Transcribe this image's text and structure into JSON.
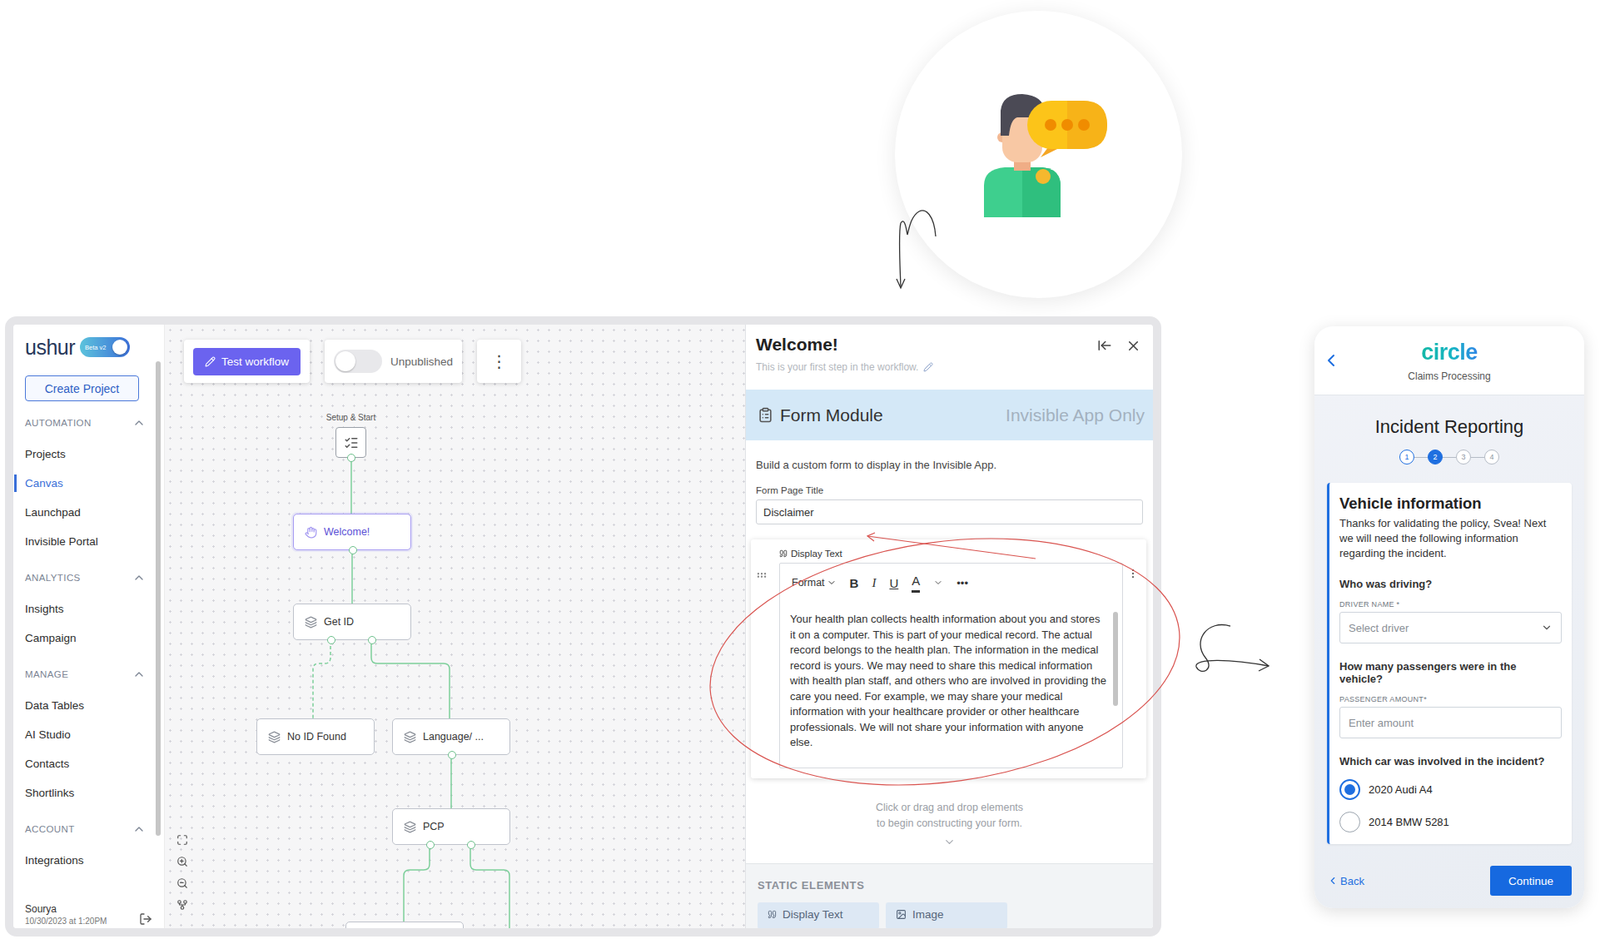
{
  "sidebar": {
    "logo": "ushur",
    "beta_toggle": {
      "label": "Beta v2",
      "on": true
    },
    "create_button": "Create Project",
    "sections": [
      {
        "title": "AUTOMATION",
        "expanded": true,
        "items": [
          {
            "label": "Projects",
            "selected": false
          },
          {
            "label": "Canvas",
            "selected": true
          },
          {
            "label": "Launchpad",
            "selected": false
          },
          {
            "label": "Invisible Portal",
            "selected": false
          }
        ]
      },
      {
        "title": "ANALYTICS",
        "expanded": true,
        "items": [
          {
            "label": "Insights",
            "selected": false
          },
          {
            "label": "Campaign",
            "selected": false
          }
        ]
      },
      {
        "title": "MANAGE",
        "expanded": true,
        "items": [
          {
            "label": "Data Tables",
            "selected": false
          },
          {
            "label": "AI Studio",
            "selected": false
          },
          {
            "label": "Contacts",
            "selected": false
          },
          {
            "label": "Shortlinks",
            "selected": false
          }
        ]
      },
      {
        "title": "ACCOUNT",
        "expanded": true,
        "items": [
          {
            "label": "Integrations",
            "selected": false
          }
        ]
      }
    ],
    "user": {
      "name": "Sourya",
      "time": "10/30/2023 at 1:20PM"
    }
  },
  "canvas": {
    "test_button": "Test workflow",
    "publish_toggle": {
      "label": "Unpublished",
      "on": false
    },
    "menu": "⋮",
    "nodes": [
      {
        "kind": "start",
        "label": "Setup & Start",
        "selected": false
      },
      {
        "kind": "welcome",
        "label": "Welcome!",
        "selected": true
      },
      {
        "kind": "step",
        "label": "Get ID",
        "selected": false
      },
      {
        "kind": "step",
        "label": "No ID Found",
        "selected": false
      },
      {
        "kind": "step",
        "label": "Language/ ...",
        "selected": false
      },
      {
        "kind": "step",
        "label": "PCP",
        "selected": false
      },
      {
        "kind": "cut-off",
        "label": "",
        "selected": false
      }
    ],
    "edges": [
      {
        "dashed": false
      },
      {
        "dashed": false
      },
      {
        "dashed": true
      },
      {
        "dashed": false
      },
      {
        "dashed": false
      },
      {
        "dashed": false
      },
      {
        "dashed": false
      }
    ]
  },
  "panel": {
    "title": "Welcome!",
    "subtitle": "This is your first step in the workflow.",
    "module": {
      "title": "Form Module",
      "tag": "Invisible App Only"
    },
    "description": "Build a custom form to display in the Invisible App.",
    "page_title": {
      "label": "Form Page Title",
      "value": "Disclaimer"
    },
    "element": {
      "label": "Display Text",
      "toolbar": {
        "format": "Format",
        "buttons": [
          {
            "label": "B",
            "kind": "bold"
          },
          {
            "label": "I",
            "kind": "italic"
          },
          {
            "label": "U",
            "kind": "underline"
          },
          {
            "label": "A",
            "kind": "color"
          }
        ],
        "more": "•••"
      },
      "text": "Your health plan collects health information about you and stores it on a computer. This is part of your medical record. The actual record belongs to the health plan. The information in the medical record is yours. We may need to share this medical information with health plan staff, and others who are involved in providing the care you need. For example, we may share your medical information with your healthcare provider or other healthcare professionals. We will not share your information with anyone else.",
      "scroll_level": 0.68
    },
    "hint": [
      "Click or drag and drop elements",
      "to begin constructing your form."
    ],
    "static": {
      "title": "STATIC ELEMENTS",
      "items": [
        {
          "label": "Display Text",
          "kind": "text"
        },
        {
          "label": "Image",
          "kind": "image"
        }
      ]
    }
  },
  "phone": {
    "logo": "circle",
    "subtitle": "Claims Processing",
    "title": "Incident Reporting",
    "steps": [
      {
        "label": "1",
        "status": "done"
      },
      {
        "label": "2",
        "status": "current"
      },
      {
        "label": "3",
        "status": "todo"
      },
      {
        "label": "4",
        "status": "todo"
      }
    ],
    "card": {
      "title": "Vehicle information",
      "text": "Thanks for validating the policy, Svea! Next we will need the following information regarding the incident.",
      "fields": [
        {
          "kind": "select",
          "question": "Who was driving?",
          "label": "DRIVER NAME *",
          "placeholder": "Select driver"
        },
        {
          "kind": "input",
          "question": "How many passengers were in the vehicle?",
          "label": "PASSENGER AMOUNT*",
          "placeholder": "Enter amount"
        },
        {
          "kind": "radio",
          "question": "Which car was involved in the incident?",
          "options": [
            {
              "label": "2020 Audi A4",
              "selected": true
            },
            {
              "label": "2014 BMW 5281",
              "selected": false
            }
          ]
        }
      ]
    },
    "back": "Back",
    "continue": "Continue"
  }
}
